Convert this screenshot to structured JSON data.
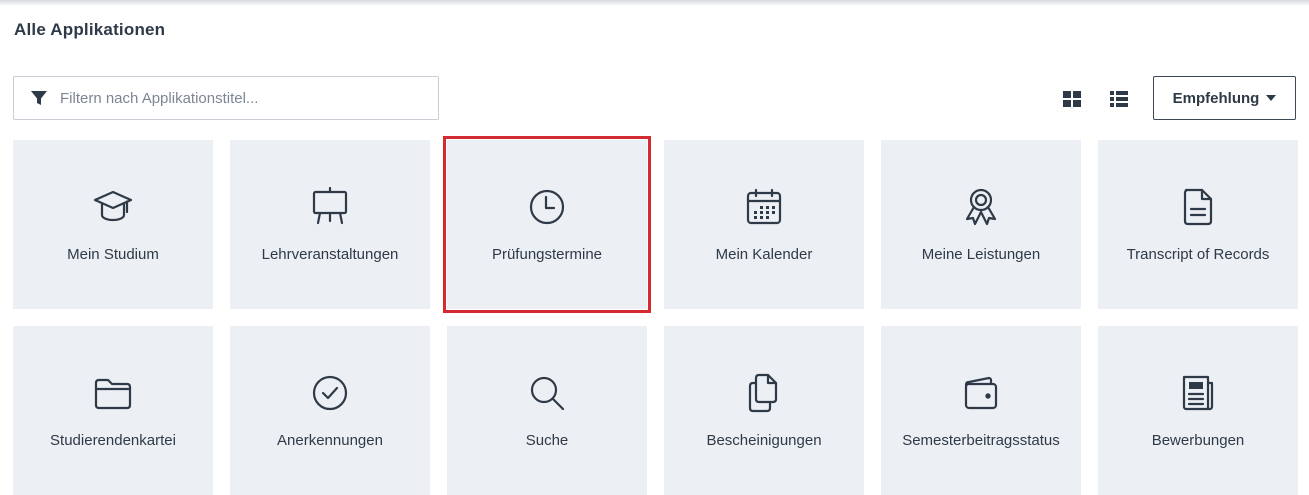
{
  "page": {
    "title": "Alle Applikationen"
  },
  "filter": {
    "placeholder": "Filtern nach Applikationstitel...",
    "value": "",
    "icon": "filter-icon"
  },
  "toolbar": {
    "grid_view_icon": "grid-view-icon",
    "list_view_icon": "list-view-icon",
    "sort_label": "Empfehlung",
    "sort_caret_icon": "caret-down-icon"
  },
  "colors": {
    "tile_bg": "#eceff3",
    "text": "#2f3a48",
    "highlight": "#d42a32"
  },
  "apps": [
    {
      "label": "Mein Studium",
      "icon": "graduation-cap-icon",
      "highlighted": false
    },
    {
      "label": "Lehrveranstaltungen",
      "icon": "easel-icon",
      "highlighted": false
    },
    {
      "label": "Prüfungstermine",
      "icon": "clock-icon",
      "highlighted": true
    },
    {
      "label": "Mein Kalender",
      "icon": "calendar-icon",
      "highlighted": false
    },
    {
      "label": "Meine Leistungen",
      "icon": "award-ribbon-icon",
      "highlighted": false
    },
    {
      "label": "Transcript of Records",
      "icon": "document-icon",
      "highlighted": false
    },
    {
      "label": "Studierendenkartei",
      "icon": "folder-icon",
      "highlighted": false
    },
    {
      "label": "Anerkennungen",
      "icon": "check-circle-icon",
      "highlighted": false
    },
    {
      "label": "Suche",
      "icon": "search-icon",
      "highlighted": false
    },
    {
      "label": "Bescheinigungen",
      "icon": "documents-copy-icon",
      "highlighted": false
    },
    {
      "label": "Semesterbeitragsstatus",
      "icon": "wallet-icon",
      "highlighted": false
    },
    {
      "label": "Bewerbungen",
      "icon": "newspaper-icon",
      "highlighted": false
    }
  ]
}
